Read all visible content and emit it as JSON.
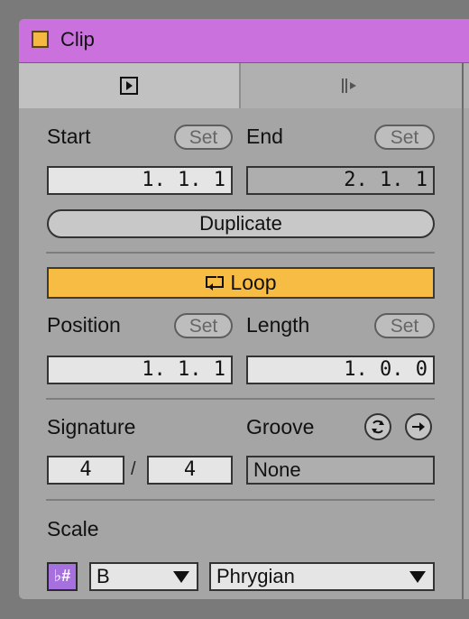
{
  "title_bar": {
    "title": "Clip",
    "color": "#ca71de",
    "swatch_color": "#f5b941"
  },
  "tabs": [
    {
      "icon": "clip-view-icon",
      "active": true
    },
    {
      "icon": "audio-sample-icon",
      "active": false
    }
  ],
  "start": {
    "label": "Start",
    "set_label": "Set",
    "value": "1. 1. 1"
  },
  "end": {
    "label": "End",
    "set_label": "Set",
    "value": "2. 1. 1"
  },
  "duplicate_label": "Duplicate",
  "loop": {
    "label": "Loop",
    "icon": "loop-icon",
    "active": true,
    "color": "#f7bc44"
  },
  "position": {
    "label": "Position",
    "set_label": "Set",
    "value": "1. 1. 1"
  },
  "length": {
    "label": "Length",
    "set_label": "Set",
    "value": "1. 0. 0"
  },
  "signature": {
    "label": "Signature",
    "numerator": "4",
    "separator": "/",
    "denominator": "4"
  },
  "groove": {
    "label": "Groove",
    "value": "None",
    "icons": [
      "groove-hot-swap-icon",
      "groove-commit-icon"
    ]
  },
  "scale": {
    "label": "Scale",
    "accidental_button": "♭#",
    "root_note": "B",
    "mode": "Phrygian",
    "accent_color": "#a671de"
  }
}
